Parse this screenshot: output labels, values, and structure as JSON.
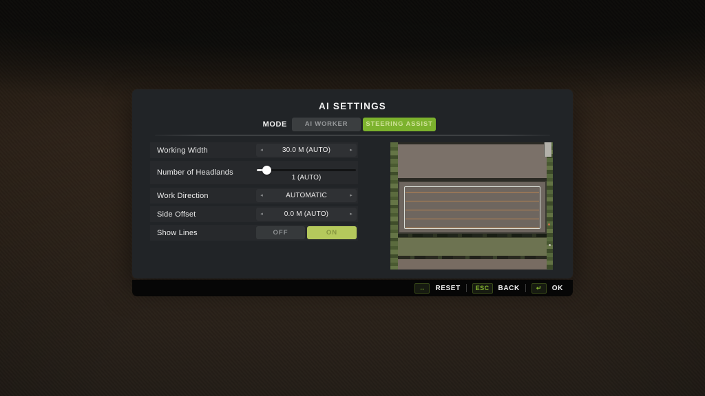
{
  "window": {
    "title": "AI SETTINGS"
  },
  "tabs": {
    "mode_label": "MODE",
    "items": [
      {
        "label": "AI WORKER",
        "selected": false
      },
      {
        "label": "STEERING ASSIST",
        "selected": true
      }
    ]
  },
  "settings": {
    "working_width": {
      "label": "Working Width",
      "value": "30.0 M (AUTO)"
    },
    "headlands": {
      "label": "Number of Headlands",
      "value": "1 (AUTO)",
      "slider_fraction": 0.1
    },
    "work_direction": {
      "label": "Work Direction",
      "value": "AUTOMATIC"
    },
    "side_offset": {
      "label": "Side Offset",
      "value": "0.0 M (AUTO)"
    },
    "show_lines": {
      "label": "Show Lines",
      "off_label": "OFF",
      "on_label": "ON",
      "value": "ON"
    }
  },
  "icons": {
    "arrow_left": "◂",
    "arrow_right": "▸",
    "reset_icon": "↔",
    "enter_icon": "↵"
  },
  "footer": {
    "reset_label": "RESET",
    "esc_key": "ESC",
    "back_label": "BACK",
    "ok_label": "OK"
  },
  "map_preview": {
    "type": "aerial-field-map",
    "work_area": {
      "outline": "light",
      "line_count": 5,
      "line_orientation": "horizontal"
    },
    "fields_top_to_bottom": [
      "brown-field",
      "active-field-with-work-lines",
      "hedge-strip",
      "olive-field",
      "brown-field"
    ],
    "side_strips": "green-vegetation"
  },
  "colors": {
    "accent-green": "#7cb22d",
    "accent-green-text": "#cde096",
    "on-green": "#b5c95c",
    "on-green-text": "#84943e",
    "key-green": "#85b62f",
    "panel": "#212427",
    "row": "#27292c",
    "control": "#2f3134",
    "footer": "#060606",
    "text-white": "#f1f1f1",
    "text-gray": "#97999b",
    "map-orange": "#bd8550",
    "map-outline": "#d9ddd6",
    "map-veg": "#5b6b3e",
    "map-field-top": "#7b7169",
    "map-field-mid": "#6e665f",
    "map-field-olive": "#6d7351",
    "map-field-bottom": "#786c62",
    "map-hedge": "#22271d"
  }
}
